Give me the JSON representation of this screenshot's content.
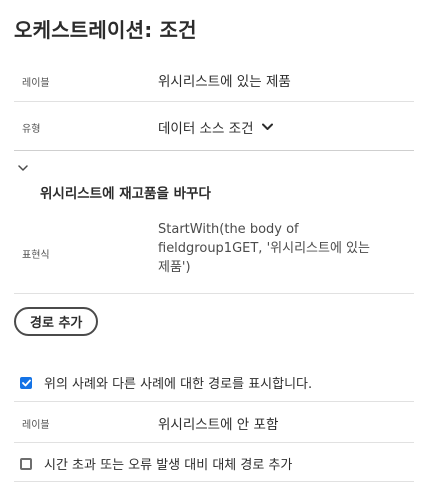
{
  "page": {
    "title": "오케스트레이션: 조건"
  },
  "condition": {
    "label_field": "레이블",
    "label_value": "위시리스트에 있는 제품",
    "type_field": "유형",
    "type_value": "데이터 소스 조건"
  },
  "path": {
    "title": "위시리스트에 재고품을 바꾸다",
    "expression_field": "표현식",
    "expression_value": "StartWith(the body of fieldgroup1GET, '위시리스트에 있는 제품')"
  },
  "actions": {
    "add_path_label": "경로 추가"
  },
  "other_cases": {
    "checkbox_label": "위의 사례와 다른 사례에 대한 경로를 표시합니다.",
    "checked": true,
    "label_field": "레이블",
    "label_value": "위시리스트에 안 포함"
  },
  "timeout": {
    "checkbox_label": "시간 초과 또는 오류 발생 대비 대체 경로 추가",
    "checked": false
  },
  "colors": {
    "accent": "#1473e6",
    "text": "#2c2c2c",
    "divider": "#e1e1e1"
  }
}
